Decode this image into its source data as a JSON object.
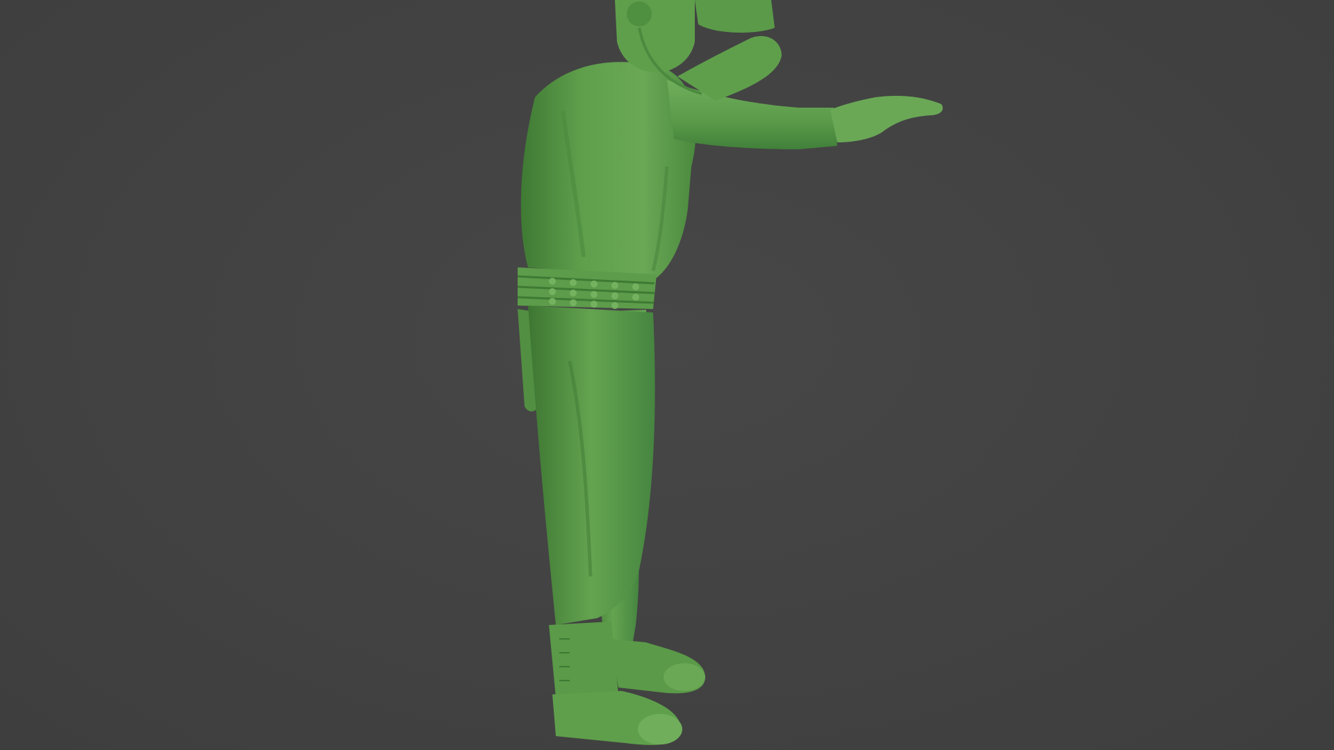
{
  "scene": {
    "subject_icon": "green-toy-soldier-figure",
    "background_color": "#424242",
    "figure_base_color": "#5a9a48",
    "figure_shadow_color": "#3f7a34",
    "figure_highlight_color": "#7ab868"
  }
}
